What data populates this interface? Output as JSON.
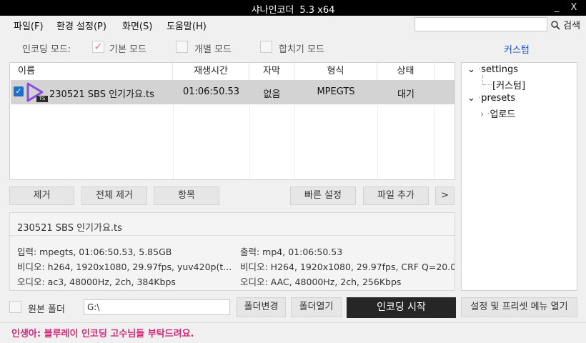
{
  "window": {
    "title": "샤나인코더",
    "version": "5.3 x64",
    "minimize": "_",
    "close": "X"
  },
  "menu": {
    "items": [
      "파일(F)",
      "환경 설정(P)",
      "화면(S)",
      "도움말(H)"
    ],
    "search_label": "검색",
    "search_value": ""
  },
  "modes": {
    "label": "인코딩 모드:",
    "basic": {
      "label": "기본 모드",
      "checked": true
    },
    "individual": {
      "label": "개별 모드",
      "checked": false
    },
    "merge": {
      "label": "합치기 모드",
      "checked": false
    },
    "custom": "커스텀"
  },
  "table": {
    "columns": [
      "이름",
      "재생시간",
      "자막",
      "형식",
      "상태"
    ],
    "rows": [
      {
        "checked": true,
        "badge": "TS",
        "name": "230521 SBS 인기가요.ts",
        "duration": "01:06:50.53",
        "subtitle": "없음",
        "format": "MPEGTS",
        "status": "대기"
      }
    ]
  },
  "list_buttons": {
    "remove": "제거",
    "remove_all": "전체 제거",
    "item": "항목",
    "quick_settings": "빠른 설정",
    "add_file": "파일 추가",
    "more": ">"
  },
  "tree": {
    "nodes": [
      {
        "label": "settings",
        "children": [
          "[커스텀]"
        ]
      },
      {
        "label": "presets",
        "children": [
          "업로드"
        ]
      }
    ]
  },
  "info": {
    "filename": "230521 SBS 인기가요.ts",
    "input": "입력: mpegts, 01:06:50.53, 5.85GB",
    "input_video": "비디오: h264, 1920x1080, 29.97fps,  yuv420p(t...",
    "input_audio": "오디오: ac3, 48000Hz, 2ch, 384Kbps",
    "output": "출력: mp4, 01:06:50.53",
    "output_video": "비디오: H264, 1920x1080, 29.97fps, CRF Q=20.0",
    "output_audio": "오디오: AAC, 48000Hz, 2ch, 256Kbps"
  },
  "bottom": {
    "original_folder": "원본 폴더",
    "folder_path": "G:\\",
    "change_folder": "폴더변경",
    "open_folder": "폴더열기",
    "start_encoding": "인코딩 시작",
    "settings_menu": "설정 및 프리셋 메뉴 열기"
  },
  "status_message": "인생아: 블루레이 인코딩 고수님들 부탁드려요.",
  "colors": {
    "titlebar": "#000000",
    "accent_link": "#1b4fbf",
    "status_text": "#d8277a",
    "row_selected": "#d3d3d3",
    "play_icon": "#8a4fd8",
    "start_button": "#262626"
  }
}
